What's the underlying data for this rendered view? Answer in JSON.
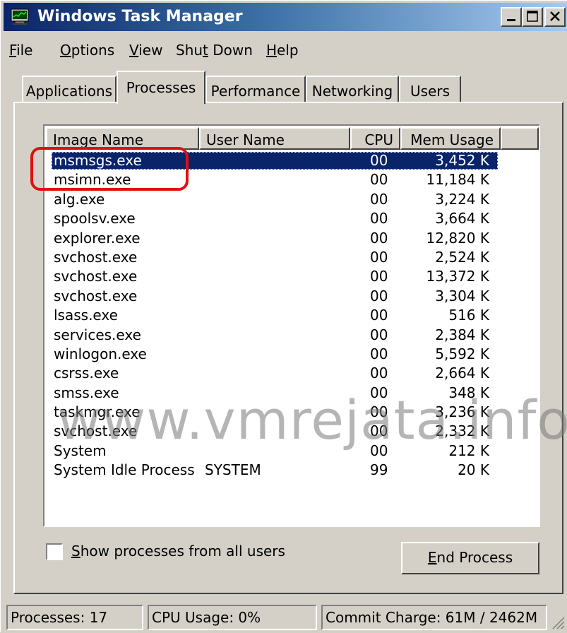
{
  "window": {
    "title": "Windows Task Manager",
    "icon": "task-manager-icon",
    "controls": [
      "minimize-icon",
      "maximize-icon",
      "close-icon"
    ]
  },
  "menu": {
    "file": {
      "hot": "F",
      "rest": "ile"
    },
    "options": {
      "hot": "O",
      "rest": "ptions"
    },
    "view": {
      "hot": "V",
      "rest": "iew"
    },
    "shutdown": {
      "pre": "Shu",
      "hot": "t",
      "rest": " Down"
    },
    "help": {
      "hot": "H",
      "rest": "elp"
    }
  },
  "tabs": [
    "Applications",
    "Processes",
    "Performance",
    "Networking",
    "Users"
  ],
  "active_tab": "Processes",
  "columns": [
    "Image Name",
    "User Name",
    "CPU",
    "Mem Usage"
  ],
  "processes": [
    {
      "name": "msmsgs.exe",
      "user": "",
      "cpu": "00",
      "mem": "3,452 K"
    },
    {
      "name": "msimn.exe",
      "user": "",
      "cpu": "00",
      "mem": "11,184 K"
    },
    {
      "name": "alg.exe",
      "user": "",
      "cpu": "00",
      "mem": "3,224 K"
    },
    {
      "name": "spoolsv.exe",
      "user": "",
      "cpu": "00",
      "mem": "3,664 K"
    },
    {
      "name": "explorer.exe",
      "user": "",
      "cpu": "00",
      "mem": "12,820 K"
    },
    {
      "name": "svchost.exe",
      "user": "",
      "cpu": "00",
      "mem": "2,524 K"
    },
    {
      "name": "svchost.exe",
      "user": "",
      "cpu": "00",
      "mem": "13,372 K"
    },
    {
      "name": "svchost.exe",
      "user": "",
      "cpu": "00",
      "mem": "3,304 K"
    },
    {
      "name": "lsass.exe",
      "user": "",
      "cpu": "00",
      "mem": "516 K"
    },
    {
      "name": "services.exe",
      "user": "",
      "cpu": "00",
      "mem": "2,384 K"
    },
    {
      "name": "winlogon.exe",
      "user": "",
      "cpu": "00",
      "mem": "5,592 K"
    },
    {
      "name": "csrss.exe",
      "user": "",
      "cpu": "00",
      "mem": "2,664 K"
    },
    {
      "name": "smss.exe",
      "user": "",
      "cpu": "00",
      "mem": "348 K"
    },
    {
      "name": "taskmgr.exe",
      "user": "",
      "cpu": "00",
      "mem": "3,236 K"
    },
    {
      "name": "svchost.exe",
      "user": "",
      "cpu": "00",
      "mem": "2,332 K"
    },
    {
      "name": "System",
      "user": "",
      "cpu": "00",
      "mem": "212 K"
    },
    {
      "name": "System Idle Process",
      "user": "SYSTEM",
      "cpu": "99",
      "mem": "20 K"
    }
  ],
  "selected_row": 0,
  "show_all_users": {
    "hot": "S",
    "rest": "how processes from all users",
    "checked": false
  },
  "end_process": {
    "hot": "E",
    "rest": "nd Process"
  },
  "status": {
    "processes": "Processes: 17",
    "cpu": "CPU Usage: 0%",
    "commit": "Commit Charge: 61M / 2462M"
  },
  "watermark": "www.vmrejata.info",
  "colors": {
    "face": "#d4d0c8",
    "title_start": "#0a246a",
    "title_end": "#a6caf0",
    "selection": "#0a246a",
    "highlight_ring": "#e01010"
  }
}
